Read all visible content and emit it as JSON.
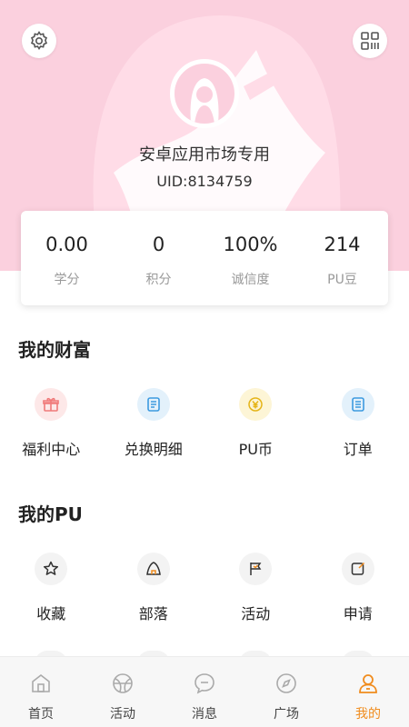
{
  "header": {
    "username": "安卓应用市场专用",
    "uid": "UID:8134759",
    "colors": {
      "background": "#fbd0de",
      "art": "#ffe0ea"
    }
  },
  "stats": [
    {
      "value": "0.00",
      "label": "学分"
    },
    {
      "value": "0",
      "label": "积分"
    },
    {
      "value": "100%",
      "label": "诚信度"
    },
    {
      "value": "214",
      "label": "PU豆"
    }
  ],
  "wealth": {
    "title": "我的财富",
    "items": [
      {
        "label": "福利中心",
        "icon": "gift-icon",
        "color": "#f07a7a",
        "bg": "#fde8e8"
      },
      {
        "label": "兑换明细",
        "icon": "exchange-list-icon",
        "color": "#3c9ae0",
        "bg": "#e3f1fb"
      },
      {
        "label": "PU币",
        "icon": "coin-icon",
        "color": "#e5b418",
        "bg": "#fdf5d6"
      },
      {
        "label": "订单",
        "icon": "order-icon",
        "color": "#3c9ae0",
        "bg": "#e3f1fb"
      }
    ]
  },
  "pu": {
    "title": "我的PU",
    "items": [
      {
        "label": "收藏",
        "icon": "star-icon",
        "color": "#333333",
        "bg": "#f3f3f3"
      },
      {
        "label": "部落",
        "icon": "tribe-icon",
        "color": "#f08c1e",
        "bg": "#f3f3f3"
      },
      {
        "label": "活动",
        "icon": "flag-icon",
        "color": "#f08c1e",
        "bg": "#f3f3f3"
      },
      {
        "label": "申请",
        "icon": "edit-icon",
        "color": "#f08c1e",
        "bg": "#f3f3f3"
      }
    ]
  },
  "nav": {
    "active_color": "#f08c1e",
    "items": [
      {
        "label": "首页",
        "icon": "home-icon"
      },
      {
        "label": "活动",
        "icon": "ball-icon"
      },
      {
        "label": "消息",
        "icon": "message-icon"
      },
      {
        "label": "广场",
        "icon": "compass-icon"
      },
      {
        "label": "我的",
        "icon": "profile-icon",
        "active": true
      }
    ]
  }
}
